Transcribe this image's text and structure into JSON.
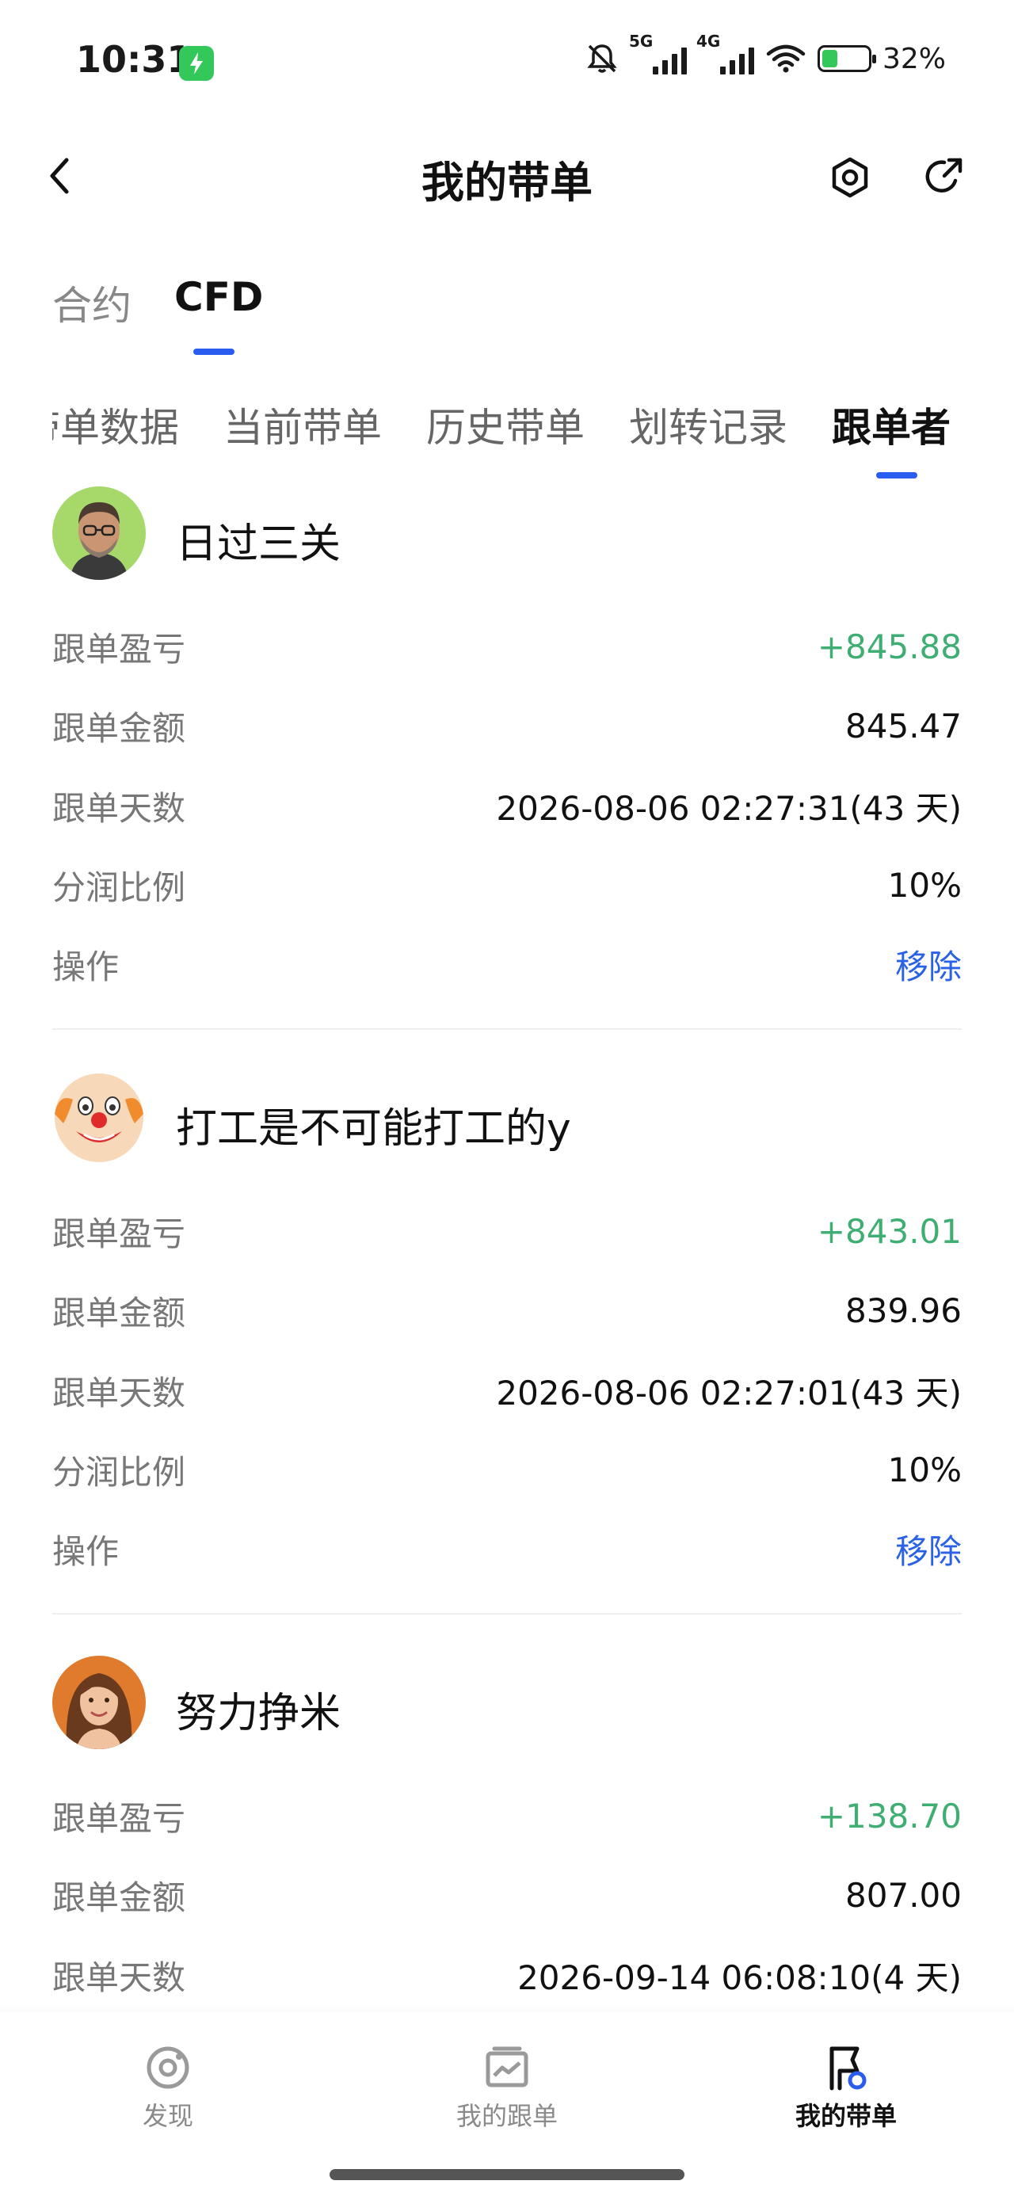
{
  "status_bar": {
    "time": "10:31",
    "net_5g": "5G",
    "net_4g": "4G",
    "battery": "32%"
  },
  "header": {
    "title": "我的带单",
    "back_icon": "chevron-left-icon",
    "settings_icon": "gear-icon",
    "share_icon": "share-icon"
  },
  "product_tabs": [
    {
      "label": "合约",
      "active": false
    },
    {
      "label": "CFD",
      "active": true
    }
  ],
  "sub_tabs": [
    {
      "label": "带单数据",
      "active": false
    },
    {
      "label": "当前带单",
      "active": false
    },
    {
      "label": "历史带单",
      "active": false
    },
    {
      "label": "划转记录",
      "active": false
    },
    {
      "label": "跟单者",
      "active": true
    }
  ],
  "followers": [
    {
      "name": "日过三关",
      "avatar_icon": "avatar-man-glasses",
      "rows": [
        {
          "label": "跟单盈亏",
          "value": "+845.88",
          "type": "pos"
        },
        {
          "label": "跟单金额",
          "value": "845.47",
          "type": ""
        },
        {
          "label": "跟单天数",
          "value": "2026-08-06 02:27:31(43 天)",
          "type": ""
        },
        {
          "label": "分润比例",
          "value": "10%",
          "type": ""
        },
        {
          "label": "操作",
          "value": "移除",
          "type": "link"
        }
      ]
    },
    {
      "name": "打工是不可能打工的y",
      "avatar_icon": "avatar-clown",
      "rows": [
        {
          "label": "跟单盈亏",
          "value": "+843.01",
          "type": "pos"
        },
        {
          "label": "跟单金额",
          "value": "839.96",
          "type": ""
        },
        {
          "label": "跟单天数",
          "value": "2026-08-06 02:27:01(43 天)",
          "type": ""
        },
        {
          "label": "分润比例",
          "value": "10%",
          "type": ""
        },
        {
          "label": "操作",
          "value": "移除",
          "type": "link"
        }
      ]
    },
    {
      "name": "努力挣米",
      "avatar_icon": "avatar-woman",
      "rows": [
        {
          "label": "跟单盈亏",
          "value": "+138.70",
          "type": "pos"
        },
        {
          "label": "跟单金额",
          "value": "807.00",
          "type": ""
        },
        {
          "label": "跟单天数",
          "value": "2026-09-14 06:08:10(4 天)",
          "type": ""
        }
      ]
    }
  ],
  "bottom_nav": [
    {
      "label": "发现",
      "icon": "discover-icon",
      "active": false
    },
    {
      "label": "我的跟单",
      "icon": "chart-box-icon",
      "active": false
    },
    {
      "label": "我的带单",
      "icon": "flag-icon",
      "active": true
    }
  ],
  "colors": {
    "accent": "#2a5cf0",
    "positive": "#3fae73",
    "link": "#2a62e6"
  }
}
